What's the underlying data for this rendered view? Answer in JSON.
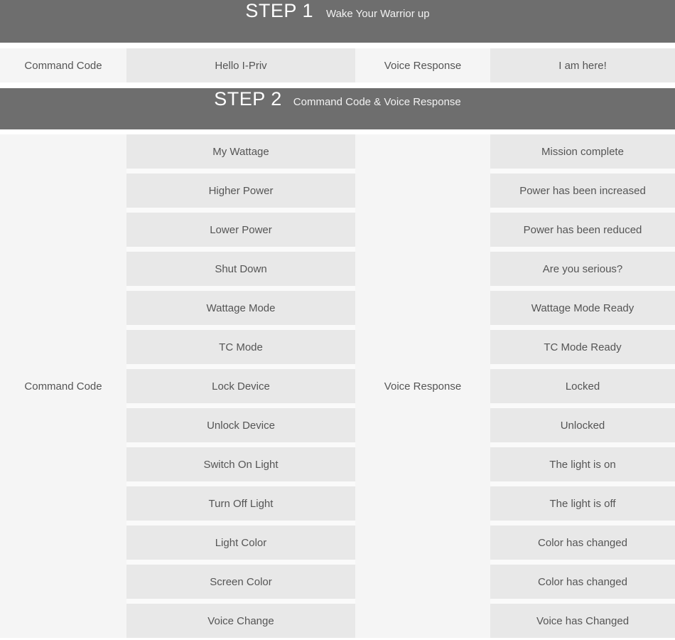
{
  "colors": {
    "banner_bg": "#6e6e6e",
    "banner_text": "#ffffff",
    "cell_bg": "#e8e8e8",
    "label_bg": "#f5f5f5",
    "text": "#555555",
    "page_bg": "#ffffff"
  },
  "step1": {
    "title": "STEP 1",
    "subtitle": "Wake Your Warrior up",
    "command_label": "Command Code",
    "command_value": "Hello I-Priv",
    "response_label": "Voice Response",
    "response_value": "I am here!"
  },
  "step2": {
    "title": "STEP 2",
    "subtitle": "Command Code & Voice Response",
    "command_label": "Command Code",
    "response_label": "Voice Response",
    "rows": [
      {
        "command": "My Wattage",
        "response": "Mission complete"
      },
      {
        "command": "Higher Power",
        "response": "Power has been increased"
      },
      {
        "command": "Lower Power",
        "response": "Power has been reduced"
      },
      {
        "command": "Shut Down",
        "response": "Are you serious?"
      },
      {
        "command": "Wattage Mode",
        "response": "Wattage Mode Ready"
      },
      {
        "command": "TC Mode",
        "response": "TC Mode Ready"
      },
      {
        "command": "Lock Device",
        "response": "Locked"
      },
      {
        "command": "Unlock Device",
        "response": "Unlocked"
      },
      {
        "command": "Switch On Light",
        "response": "The light is on"
      },
      {
        "command": "Turn Off Light",
        "response": "The light is off"
      },
      {
        "command": "Light Color",
        "response": "Color has changed"
      },
      {
        "command": "Screen Color",
        "response": "Color has changed"
      },
      {
        "command": "Voice Change",
        "response": "Voice has Changed"
      }
    ]
  }
}
